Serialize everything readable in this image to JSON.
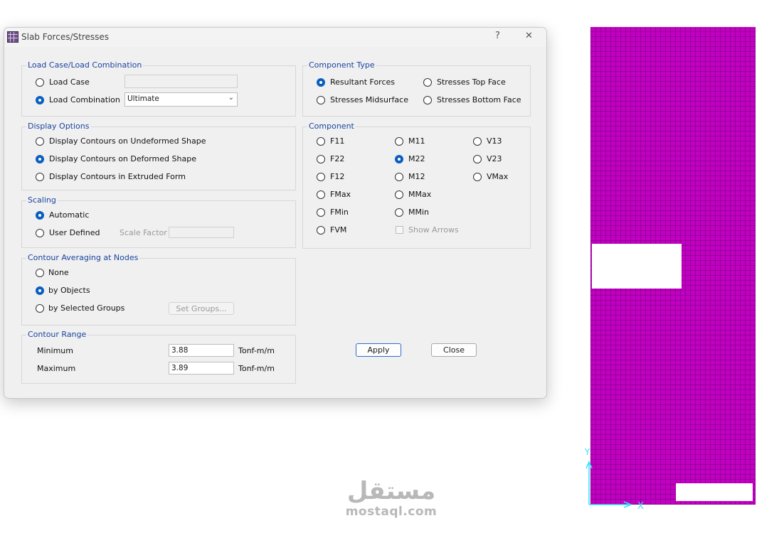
{
  "dialog": {
    "title": "Slab Forces/Stresses",
    "help_label": "?",
    "close_glyph": "✕",
    "icon": "slab-grid-icon"
  },
  "load_case_group": {
    "label": "Load Case/Load Combination",
    "load_case": "Load Case",
    "load_case_value": "",
    "load_combination": "Load Combination",
    "combo_value": "Ultimate",
    "selected": "Load Combination"
  },
  "display_options": {
    "label": "Display Options",
    "items": [
      "Display Contours on Undeformed Shape",
      "Display Contours on Deformed Shape",
      "Display Contours in Extruded Form"
    ],
    "selected": "Display Contours on Deformed Shape"
  },
  "scaling": {
    "label": "Scaling",
    "automatic": "Automatic",
    "user_defined": "User Defined",
    "scale_factor_label": "Scale Factor",
    "scale_factor_value": "",
    "selected": "Automatic"
  },
  "averaging": {
    "label": "Contour Averaging at Nodes",
    "items": [
      "None",
      "by Objects",
      "by Selected Groups"
    ],
    "set_groups_label": "Set Groups...",
    "selected": "by Objects"
  },
  "contour_range": {
    "label": "Contour Range",
    "min_label": "Minimum",
    "min_value": "3.88",
    "max_label": "Maximum",
    "max_value": "3.89",
    "unit": "Tonf-m/m"
  },
  "component_type": {
    "label": "Component Type",
    "items": [
      "Resultant Forces",
      "Stresses Top Face",
      "Stresses Midsurface",
      "Stresses Bottom Face"
    ],
    "selected": "Resultant Forces"
  },
  "component": {
    "label": "Component",
    "col1": [
      "F11",
      "F22",
      "F12",
      "FMax",
      "FMin",
      "FVM"
    ],
    "col2": [
      "M11",
      "M22",
      "M12",
      "MMax",
      "MMin"
    ],
    "col3": [
      "V13",
      "V23",
      "VMax"
    ],
    "selected": "M22",
    "show_arrows": "Show Arrows"
  },
  "buttons": {
    "apply": "Apply",
    "close": "Close"
  },
  "plot": {
    "fill_color": "#c200c2",
    "axis_color": "#33e0ff",
    "axis_y": "Y",
    "axis_x": "X"
  },
  "watermark": {
    "arabic": "مستقل",
    "latin": "mostaql.com"
  }
}
